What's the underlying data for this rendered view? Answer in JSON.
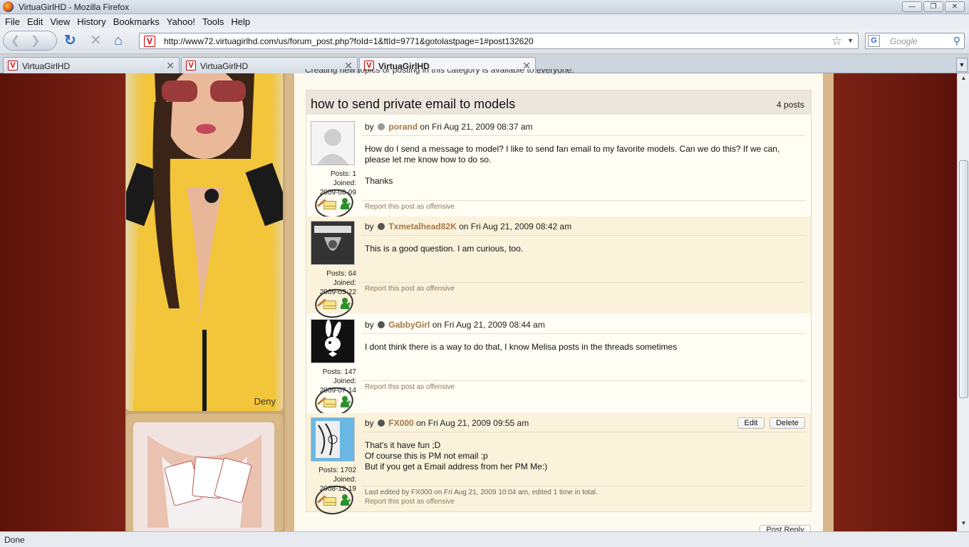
{
  "window": {
    "title": "VirtuaGirlHD - Mozilla Firefox",
    "controls": [
      "minimize",
      "restore",
      "close"
    ]
  },
  "menu": [
    "File",
    "Edit",
    "View",
    "History",
    "Bookmarks",
    "Yahoo!",
    "Tools",
    "Help"
  ],
  "nav": {
    "url": "http://www72.virtuagirlhd.com/us/forum_post.php?foId=1&ftId=9771&gotolastpage=1#post132620",
    "search_placeholder": "Google"
  },
  "tabs": [
    {
      "label": "VirtuaGirlHD",
      "active": false
    },
    {
      "label": "VirtuaGirlHD",
      "active": false
    },
    {
      "label": "VirtuaGirlHD",
      "active": true
    }
  ],
  "sidebar": {
    "photo_caption": "Deny"
  },
  "forum": {
    "top_note": "Creating new topics or posting in this category is available to everyone.",
    "thread_title": "how to send private email to models",
    "post_count": "4 posts",
    "posts": [
      {
        "by": "by",
        "username": "porand",
        "date": "on Fri Aug 21, 2009 08:37 am",
        "posts_label": "Posts: 1",
        "joined_label": "Joined:",
        "joined_date": "2009-08-09",
        "body": [
          "How do I send a message to model? I like to send fan email to my favorite models. Can we do this? If we can, please let me know how to do so.",
          "",
          "Thanks"
        ],
        "report": "Report this post as offensive"
      },
      {
        "by": "by",
        "username": "Txmetalhead82K",
        "date": "on Fri Aug 21, 2009 08:42 am",
        "posts_label": "Posts: 64",
        "joined_label": "Joined:",
        "joined_date": "2009-03-22",
        "body": [
          "This is a good question. I am curious, too."
        ],
        "report": "Report this post as offensive"
      },
      {
        "by": "by",
        "username": "GabbyGirl",
        "date": "on Fri Aug 21, 2009 08:44 am",
        "posts_label": "Posts: 147",
        "joined_label": "Joined:",
        "joined_date": "2009-07-14",
        "body": [
          "I dont think there is a way to do that, I know Melisa posts in the threads sometimes"
        ],
        "report": "Report this post as offensive"
      },
      {
        "by": "by",
        "username": "FX000",
        "date": "on Fri Aug 21, 2009 09:55 am",
        "posts_label": "Posts: 1702",
        "joined_label": "Joined:",
        "joined_date": "2008-12-19",
        "body": [
          "That's it have fun ;D",
          "Of course this is PM not email :p",
          "But if you get a Email address from her PM Me:)"
        ],
        "edit_note": "Last edited by FX000 on Fri Aug 21, 2009 10:04 am, edited 1 time in total.",
        "report": "Report this post as offensive",
        "edit_label": "Edit",
        "delete_label": "Delete"
      }
    ],
    "post_reply_label": "Post Reply"
  },
  "status": "Done"
}
